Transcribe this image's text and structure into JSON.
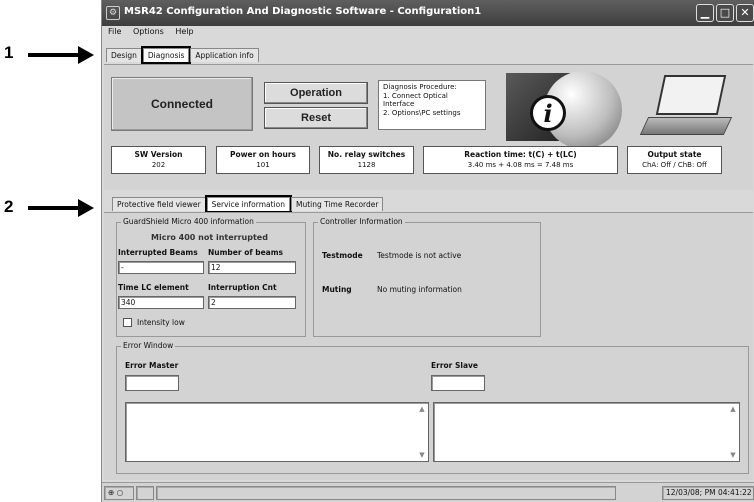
{
  "callouts": {
    "first": "1",
    "second": "2"
  },
  "window": {
    "title": "MSR42 Configuration And Diagnostic Software - Configuration1"
  },
  "menu": [
    "File",
    "Options",
    "Help"
  ],
  "main_tabs": [
    "Design",
    "Diagnosis",
    "Application info"
  ],
  "connection_status": "Connected",
  "buttons": {
    "operation": "Operation",
    "reset": "Reset"
  },
  "diagnosis_procedure": [
    "Diagnosis Procedure:",
    "1. Connect Optical",
    "Interface",
    "2. Options\\PC settings"
  ],
  "info_symbol": "i",
  "stats": [
    {
      "label": "SW Version",
      "value": "202"
    },
    {
      "label": "Power on hours",
      "value": "101"
    },
    {
      "label": "No. relay switches",
      "value": "1128"
    },
    {
      "label": "Reaction time: t(C) + t(LC)",
      "value": "3.40 ms + 4.08 ms = 7.48 ms"
    },
    {
      "label": "Output state",
      "value": "ChA: Off / ChB: Off"
    }
  ],
  "sub_tabs": [
    "Protective field viewer",
    "Service information",
    "Muting Time Recorder"
  ],
  "guardshield": {
    "title": "GuardShield Micro 400 information",
    "status": "Micro 400 not interrupted",
    "interrupted_beams_label": "Interrupted Beams",
    "interrupted_beams_value": "-",
    "number_of_beams_label": "Number of beams",
    "number_of_beams_value": "12",
    "time_lc_label": "Time LC element",
    "time_lc_value": "340",
    "interruption_cnt_label": "Interruption Cnt",
    "interruption_cnt_value": "2",
    "intensity_label": "Intensity low"
  },
  "controller": {
    "title": "Controller Information",
    "testmode_label": "Testmode",
    "testmode_value": "Testmode is not active",
    "muting_label": "Muting",
    "muting_value": "No muting information"
  },
  "error_window": {
    "title": "Error Window",
    "master_label": "Error Master",
    "slave_label": "Error Slave"
  },
  "statusbar": {
    "datetime": "12/03/08; PM 04:41:22"
  }
}
